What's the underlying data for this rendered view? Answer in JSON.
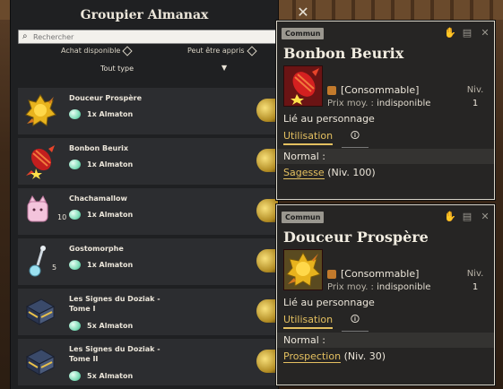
{
  "shop": {
    "title": "Groupier Almanax",
    "search_placeholder": "Rechercher",
    "filter_available": "Achat disponible",
    "filter_learnable": "Peut être appris",
    "type_select": "Tout type",
    "items": [
      {
        "name": "Douceur Prospère",
        "price": "1x Almaton",
        "badge": ""
      },
      {
        "name": "Bonbon Beurix",
        "price": "1x Almaton",
        "badge": ""
      },
      {
        "name": "Chachamallow",
        "price": "1x Almaton",
        "badge": "10"
      },
      {
        "name": "Gostomorphe",
        "price": "1x Almaton",
        "badge": "5"
      },
      {
        "name": "Les Signes du Doziak - Tome I",
        "price": "5x Almaton",
        "badge": ""
      },
      {
        "name": "Les Signes du Doziak - Tome II",
        "price": "5x Almaton",
        "badge": ""
      }
    ]
  },
  "tooltips": [
    {
      "rarity": "Commun",
      "name": "Bonbon Beurix",
      "category": "[Consommable]",
      "avg_price_label": "Prix moy. :",
      "avg_price_value": "indisponible",
      "level_label": "Niv.",
      "level_value": "1",
      "bound": "Lié au personnage",
      "tab_usage": "Utilisation",
      "tab_info": "🛈",
      "normal_label": "Normal :",
      "effect_stat": "Sagesse",
      "effect_level": "(Niv. 100)"
    },
    {
      "rarity": "Commun",
      "name": "Douceur Prospère",
      "category": "[Consommable]",
      "avg_price_label": "Prix moy. :",
      "avg_price_value": "indisponible",
      "level_label": "Niv.",
      "level_value": "1",
      "bound": "Lié au personnage",
      "tab_usage": "Utilisation",
      "tab_info": "🛈",
      "normal_label": "Normal :",
      "effect_stat": "Prospection",
      "effect_level": "(Niv. 30)"
    }
  ],
  "icons": {
    "search": "search-icon",
    "close": "close-icon",
    "hand": "hand-icon",
    "scroll": "scroll-icon",
    "info": "info-icon"
  },
  "colors": {
    "panel_bg": "#1f2022",
    "row_bg": "#2c2d30",
    "accent_gold": "#e4c060",
    "rarity_badge": "#9a978f"
  }
}
